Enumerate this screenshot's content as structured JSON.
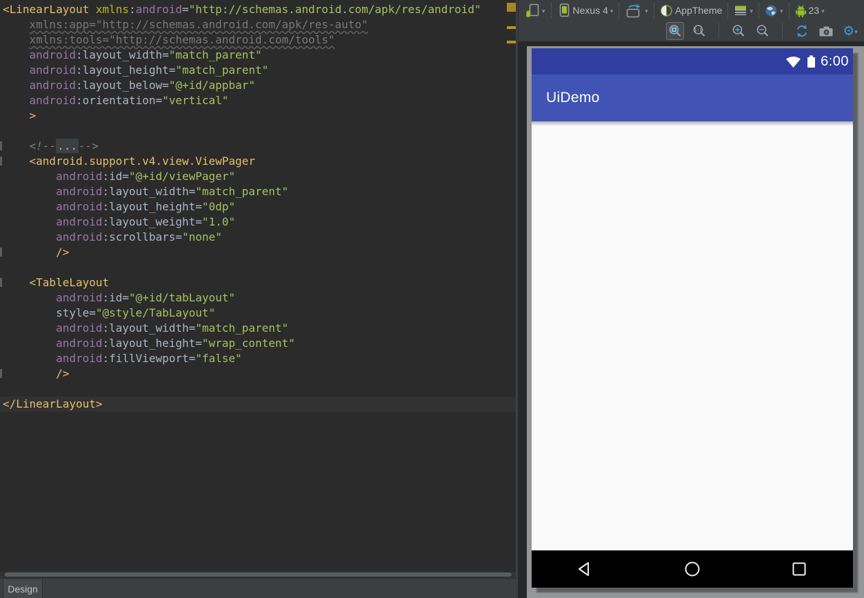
{
  "editor": {
    "lines": [
      {
        "tokens": [
          [
            "tag",
            "<LinearLayout"
          ],
          [
            "plain",
            " "
          ],
          [
            "xmlns",
            "xmlns"
          ],
          [
            "plain",
            ":"
          ],
          [
            "ns",
            "android"
          ],
          [
            "plain",
            "="
          ],
          [
            "val",
            "\"http://schemas.android.com/apk/res/android\""
          ]
        ]
      },
      {
        "tokens": [
          [
            "plain",
            "    "
          ],
          [
            "dead",
            "xmlns:app=\"http://schemas.android.com/apk/res-auto\""
          ]
        ]
      },
      {
        "tokens": [
          [
            "plain",
            "    "
          ],
          [
            "dead",
            "xmlns:tools=\"http://schemas.android.com/tools\""
          ]
        ]
      },
      {
        "tokens": [
          [
            "plain",
            "    "
          ],
          [
            "ns",
            "android"
          ],
          [
            "plain",
            ":"
          ],
          [
            "attr",
            "layout_width"
          ],
          [
            "plain",
            "="
          ],
          [
            "val",
            "\"match_parent\""
          ]
        ]
      },
      {
        "tokens": [
          [
            "plain",
            "    "
          ],
          [
            "ns",
            "android"
          ],
          [
            "plain",
            ":"
          ],
          [
            "attr",
            "layout_height"
          ],
          [
            "plain",
            "="
          ],
          [
            "val",
            "\"match_parent\""
          ]
        ]
      },
      {
        "tokens": [
          [
            "plain",
            "    "
          ],
          [
            "ns",
            "android"
          ],
          [
            "plain",
            ":"
          ],
          [
            "attr",
            "layout_below"
          ],
          [
            "plain",
            "="
          ],
          [
            "val",
            "\"@+id/appbar\""
          ]
        ]
      },
      {
        "tokens": [
          [
            "plain",
            "    "
          ],
          [
            "ns",
            "android"
          ],
          [
            "plain",
            ":"
          ],
          [
            "attr",
            "orientation"
          ],
          [
            "plain",
            "="
          ],
          [
            "val",
            "\"vertical\""
          ]
        ]
      },
      {
        "tokens": [
          [
            "plain",
            "    "
          ],
          [
            "tag",
            ">"
          ]
        ]
      },
      {
        "tokens": []
      },
      {
        "mark": true,
        "tokens": [
          [
            "plain",
            "    "
          ],
          [
            "comment",
            "<!--"
          ],
          [
            "fold",
            "..."
          ],
          [
            "comment",
            "-->"
          ]
        ]
      },
      {
        "mark": true,
        "tokens": [
          [
            "plain",
            "    "
          ],
          [
            "tag",
            "<android.support.v4.view.ViewPager"
          ]
        ]
      },
      {
        "tokens": [
          [
            "plain",
            "        "
          ],
          [
            "ns",
            "android"
          ],
          [
            "plain",
            ":"
          ],
          [
            "attr",
            "id"
          ],
          [
            "plain",
            "="
          ],
          [
            "val",
            "\"@+id/viewPager\""
          ]
        ]
      },
      {
        "tokens": [
          [
            "plain",
            "        "
          ],
          [
            "ns",
            "android"
          ],
          [
            "plain",
            ":"
          ],
          [
            "attr",
            "layout_width"
          ],
          [
            "plain",
            "="
          ],
          [
            "val",
            "\"match_parent\""
          ]
        ]
      },
      {
        "tokens": [
          [
            "plain",
            "        "
          ],
          [
            "ns",
            "android"
          ],
          [
            "plain",
            ":"
          ],
          [
            "attr",
            "layout_height"
          ],
          [
            "plain",
            "="
          ],
          [
            "val",
            "\"0dp\""
          ]
        ]
      },
      {
        "tokens": [
          [
            "plain",
            "        "
          ],
          [
            "ns",
            "android"
          ],
          [
            "plain",
            ":"
          ],
          [
            "attr",
            "layout_weight"
          ],
          [
            "plain",
            "="
          ],
          [
            "val",
            "\"1.0\""
          ]
        ]
      },
      {
        "tokens": [
          [
            "plain",
            "        "
          ],
          [
            "ns",
            "android"
          ],
          [
            "plain",
            ":"
          ],
          [
            "attr",
            "scrollbars"
          ],
          [
            "plain",
            "="
          ],
          [
            "val",
            "\"none\""
          ]
        ]
      },
      {
        "mark": true,
        "tokens": [
          [
            "plain",
            "        "
          ],
          [
            "tag",
            "/>"
          ]
        ]
      },
      {
        "tokens": []
      },
      {
        "mark": true,
        "tokens": [
          [
            "plain",
            "    "
          ],
          [
            "tag",
            "<TableLayout"
          ]
        ]
      },
      {
        "tokens": [
          [
            "plain",
            "        "
          ],
          [
            "ns",
            "android"
          ],
          [
            "plain",
            ":"
          ],
          [
            "attr",
            "id"
          ],
          [
            "plain",
            "="
          ],
          [
            "val",
            "\"@+id/tabLayout\""
          ]
        ]
      },
      {
        "tokens": [
          [
            "plain",
            "        "
          ],
          [
            "attr",
            "style"
          ],
          [
            "plain",
            "="
          ],
          [
            "val",
            "\"@style/TabLayout\""
          ]
        ]
      },
      {
        "tokens": [
          [
            "plain",
            "        "
          ],
          [
            "ns",
            "android"
          ],
          [
            "plain",
            ":"
          ],
          [
            "attr",
            "layout_width"
          ],
          [
            "plain",
            "="
          ],
          [
            "val",
            "\"match_parent\""
          ]
        ]
      },
      {
        "tokens": [
          [
            "plain",
            "        "
          ],
          [
            "ns",
            "android"
          ],
          [
            "plain",
            ":"
          ],
          [
            "attr",
            "layout_height"
          ],
          [
            "plain",
            "="
          ],
          [
            "val",
            "\"wrap_content\""
          ]
        ]
      },
      {
        "tokens": [
          [
            "plain",
            "        "
          ],
          [
            "ns",
            "android"
          ],
          [
            "plain",
            ":"
          ],
          [
            "attr",
            "fillViewport"
          ],
          [
            "plain",
            "="
          ],
          [
            "val",
            "\"false\""
          ]
        ]
      },
      {
        "mark": true,
        "tokens": [
          [
            "plain",
            "        "
          ],
          [
            "tag",
            "/>"
          ]
        ]
      },
      {
        "tokens": []
      },
      {
        "highlight": true,
        "tokens": [
          [
            "tag",
            "</LinearLayout>"
          ]
        ]
      }
    ],
    "token_colors": {
      "tag": "#E8BF6A",
      "namespace": "#9876AA",
      "xmlns": "#BBB529",
      "attribute": "#A9B7C6",
      "value": "#A5C261",
      "unused": "#787878",
      "comment": "#808080"
    },
    "inspection_marks": {
      "status_square_color": "#A8862D",
      "warning_dash_color": "#BE9117",
      "warning_count": 2
    },
    "bottom_tab_label": "Design"
  },
  "preview": {
    "toolbar": {
      "device_label": "Nexus 4",
      "theme_label": "AppTheme",
      "api_level_label": "23",
      "icons": {
        "config-icon": "document-with-android",
        "device-icon": "phone",
        "orientation-icon": "rotate-rectangle",
        "theme-icon": "half-filled-circle",
        "activity-icon": "window-grid",
        "locale-icon": "globe",
        "api-icon": "android-robot",
        "zoom-fit-icon": "magnifier-fit",
        "zoom-actual-icon": "magnifier-1:1",
        "zoom-in-icon": "magnifier-plus",
        "zoom-out-icon": "magnifier-minus",
        "refresh-icon": "circular-arrows",
        "screenshot-icon": "camera",
        "settings-icon": "gear",
        "gear_glyph": "⚙",
        "chevron_glyph": "▾"
      },
      "accent_blue": "#3C97CE",
      "android_green": "#97C024"
    },
    "phone": {
      "status_time": "6:00",
      "app_title": "UiDemo",
      "colors": {
        "status_bar": "#303F9F",
        "app_bar": "#4154B5",
        "content": "#FAFAFA",
        "nav_bar": "#000000",
        "canvas": "#949697"
      },
      "nav_icons": [
        "back-triangle",
        "home-circle",
        "recents-square"
      ]
    }
  }
}
